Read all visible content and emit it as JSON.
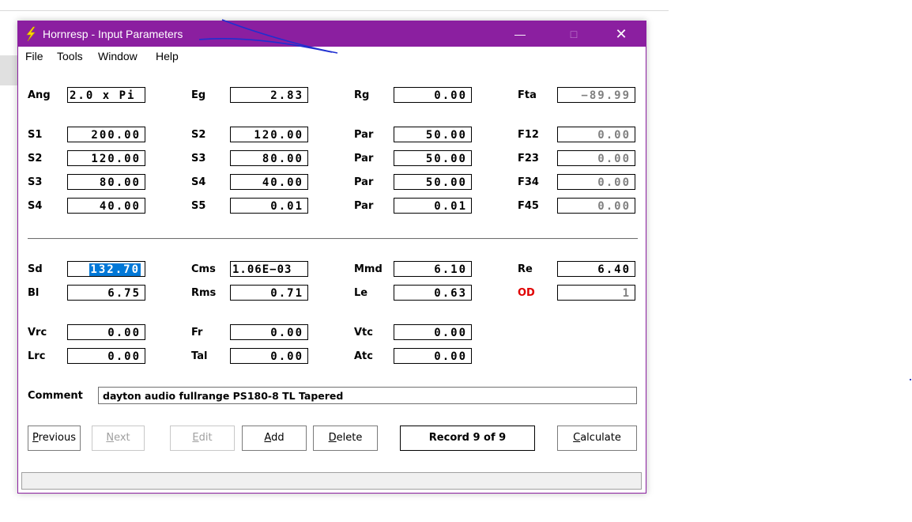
{
  "window": {
    "title": "Hornresp - Input Parameters",
    "title_bar_color": "#8b1fa0",
    "controls": {
      "minimize": "—",
      "maximize": "□",
      "close": "✕"
    }
  },
  "menu": {
    "file": "File",
    "tools": "Tools",
    "window": "Window",
    "help": "Help"
  },
  "top_row": {
    "ang": {
      "label": "Ang",
      "value": "2.0 x Pi"
    },
    "eg": {
      "label": "Eg",
      "value": "2.83"
    },
    "rg": {
      "label": "Rg",
      "value": "0.00"
    },
    "fta": {
      "label": "Fta",
      "value": "−89.99"
    }
  },
  "segments": [
    {
      "s_label": "S1",
      "s_value": "200.00",
      "s_next_label": "S2",
      "s_next_value": "120.00",
      "par_label": "Par",
      "par_value": "50.00",
      "f_label": "F12",
      "f_value": "0.00"
    },
    {
      "s_label": "S2",
      "s_value": "120.00",
      "s_next_label": "S3",
      "s_next_value": "80.00",
      "par_label": "Par",
      "par_value": "50.00",
      "f_label": "F23",
      "f_value": "0.00"
    },
    {
      "s_label": "S3",
      "s_value": "80.00",
      "s_next_label": "S4",
      "s_next_value": "40.00",
      "par_label": "Par",
      "par_value": "50.00",
      "f_label": "F34",
      "f_value": "0.00"
    },
    {
      "s_label": "S4",
      "s_value": "40.00",
      "s_next_label": "S5",
      "s_next_value": "0.01",
      "par_label": "Par",
      "par_value": "0.01",
      "f_label": "F45",
      "f_value": "0.00"
    }
  ],
  "driver": {
    "sd": {
      "label": "Sd",
      "value": "132.70"
    },
    "cms": {
      "label": "Cms",
      "value": "1.06E−03"
    },
    "mmd": {
      "label": "Mmd",
      "value": "6.10"
    },
    "re": {
      "label": "Re",
      "value": "6.40"
    },
    "bl": {
      "label": "Bl",
      "value": "6.75"
    },
    "rms": {
      "label": "Rms",
      "value": "0.71"
    },
    "le": {
      "label": "Le",
      "value": "0.63"
    },
    "od": {
      "label": "OD",
      "value": "1"
    }
  },
  "chambers": {
    "vrc": {
      "label": "Vrc",
      "value": "0.00"
    },
    "fr": {
      "label": "Fr",
      "value": "0.00"
    },
    "vtc": {
      "label": "Vtc",
      "value": "0.00"
    },
    "lrc": {
      "label": "Lrc",
      "value": "0.00"
    },
    "tal": {
      "label": "Tal",
      "value": "0.00"
    },
    "atc": {
      "label": "Atc",
      "value": "0.00"
    }
  },
  "comment": {
    "label": "Comment",
    "value": "dayton audio fullrange PS180-8 TL Tapered"
  },
  "buttons": {
    "previous": {
      "accel": "P",
      "rest": "revious"
    },
    "next": {
      "accel": "N",
      "rest": "ext"
    },
    "edit": {
      "accel": "E",
      "rest": "dit"
    },
    "add": {
      "accel": "A",
      "rest": "dd"
    },
    "delete": {
      "accel": "D",
      "rest": "elete"
    },
    "calculate": {
      "accel": "C",
      "rest": "alculate"
    }
  },
  "record_status": "Record 9 of 9",
  "colors": {
    "selection": "#0078d7",
    "warning_label": "#e00000",
    "annotation": "#1f2fd0"
  }
}
